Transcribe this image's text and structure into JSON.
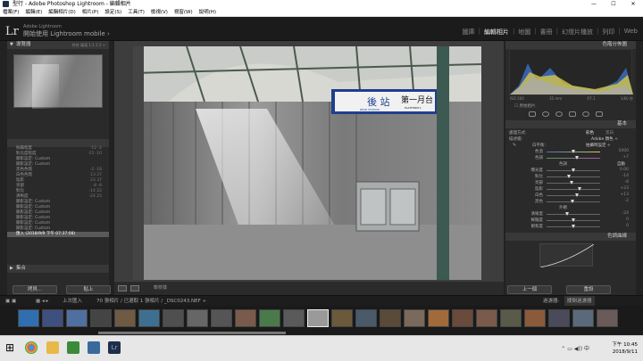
{
  "window": {
    "title": "型行 - Adobe Photoshop Lightroom - 編輯相片",
    "controls": [
      "—",
      "☐",
      "✕"
    ]
  },
  "menubar": {
    "items": [
      "檔案(F)",
      "編輯(E)",
      "編輯相片(D)",
      "相片(P)",
      "設定(S)",
      "工具(T)",
      "檢視(V)",
      "視窗(W)",
      "說明(H)"
    ]
  },
  "identity": {
    "logo": "Lr",
    "line1": "Adobe Lightroom",
    "line2": "開始使用 Lightroom mobile ›"
  },
  "modules": {
    "items": [
      "圖庫",
      "編輯相片",
      "地圖",
      "書冊",
      "幻燈片播放",
      "列印",
      "Web"
    ],
    "active_index": 1
  },
  "navigator": {
    "title": "導覽器",
    "zoom_options": "符合  填滿  1:1  2:1 ÷"
  },
  "history": {
    "items": [
      {
        "label": "除霧程度",
        "value": "-12  -2"
      },
      {
        "label": "對比度程度",
        "value": "-15  -10"
      },
      {
        "label": "顯影設定: Custom",
        "value": ""
      },
      {
        "label": "顯影設定: Custom",
        "value": ""
      },
      {
        "label": "黑色色階",
        "value": "-2  -18"
      },
      {
        "label": "白色色階",
        "value": "13  27"
      },
      {
        "label": "陰影",
        "value": "23  37"
      },
      {
        "label": "亮部",
        "value": "-8  -8"
      },
      {
        "label": "對比",
        "value": "-14  22"
      },
      {
        "label": "清晰度",
        "value": "-24  25"
      },
      {
        "label": "顯影設定: Custom",
        "value": ""
      },
      {
        "label": "顯影設定: Custom",
        "value": ""
      },
      {
        "label": "顯影設定: Custom",
        "value": ""
      },
      {
        "label": "顯影設定: Custom",
        "value": ""
      },
      {
        "label": "顯影設定: Custom",
        "value": ""
      },
      {
        "label": "顯影設定: Custom",
        "value": ""
      },
      {
        "label": "匯入 (2018/9/9 下午 07:37:08)",
        "value": ""
      }
    ],
    "selected_index": 16
  },
  "collections": {
    "title": "集合"
  },
  "left_buttons": {
    "copy": "拷貝...",
    "paste": "貼上"
  },
  "right_buttons": {
    "previous": "上一個",
    "reset": "重設"
  },
  "photo": {
    "sign_main": "後 站",
    "sign_sub": "REAR STATION",
    "platform": "第一月台",
    "platform_sub": "PLATFORM 1"
  },
  "toolbar": {
    "label": "軟校樣"
  },
  "right_panel": {
    "histogram_title": "色階分佈圖",
    "histogram_readout": [
      "ISO 200",
      "35 mm",
      "f/7.1",
      "1/60 秒"
    ],
    "original_photo": "原始相片",
    "basic_title": "基本",
    "treatment": {
      "label": "處理方式:",
      "color": "彩色",
      "bw": "黑白"
    },
    "profile": {
      "label": "描述檔:",
      "value": "Adobe 顏色 ÷"
    },
    "wb": {
      "label": "白平衡:",
      "value": "拍攝時設定 ÷"
    },
    "temp": {
      "label": "色溫",
      "value": "5000"
    },
    "tint": {
      "label": "色調",
      "value": "+7"
    },
    "tone": {
      "label": "色調",
      "auto": "自動"
    },
    "tone_sliders": [
      {
        "label": "曝光度",
        "value": "0.00",
        "pos": 0.5
      },
      {
        "label": "對比",
        "value": "-14",
        "pos": 0.42
      },
      {
        "label": "亮部",
        "value": "-8",
        "pos": 0.46
      },
      {
        "label": "陰影",
        "value": "+23",
        "pos": 0.62
      },
      {
        "label": "白色",
        "value": "+13",
        "pos": 0.57
      },
      {
        "label": "黑色",
        "value": "-2",
        "pos": 0.49
      }
    ],
    "presence": {
      "label": "外觀"
    },
    "presence_sliders": [
      {
        "label": "清晰度",
        "value": "-24",
        "pos": 0.38
      },
      {
        "label": "鮮豔度",
        "value": "0",
        "pos": 0.5
      },
      {
        "label": "飽和度",
        "value": "0",
        "pos": 0.5
      }
    ],
    "tone_curve_title": "色調曲線"
  },
  "filmstrip_bar": {
    "nav": "上次匯入",
    "info": "70 張相片 / 已選取 1 張相片 / _DSC0243.NEF ÷",
    "filter_label": "過濾器:",
    "filter_value": "關閉過濾器"
  },
  "taskbar": {
    "time": "下午 10:45",
    "date": "2018/9/11"
  }
}
